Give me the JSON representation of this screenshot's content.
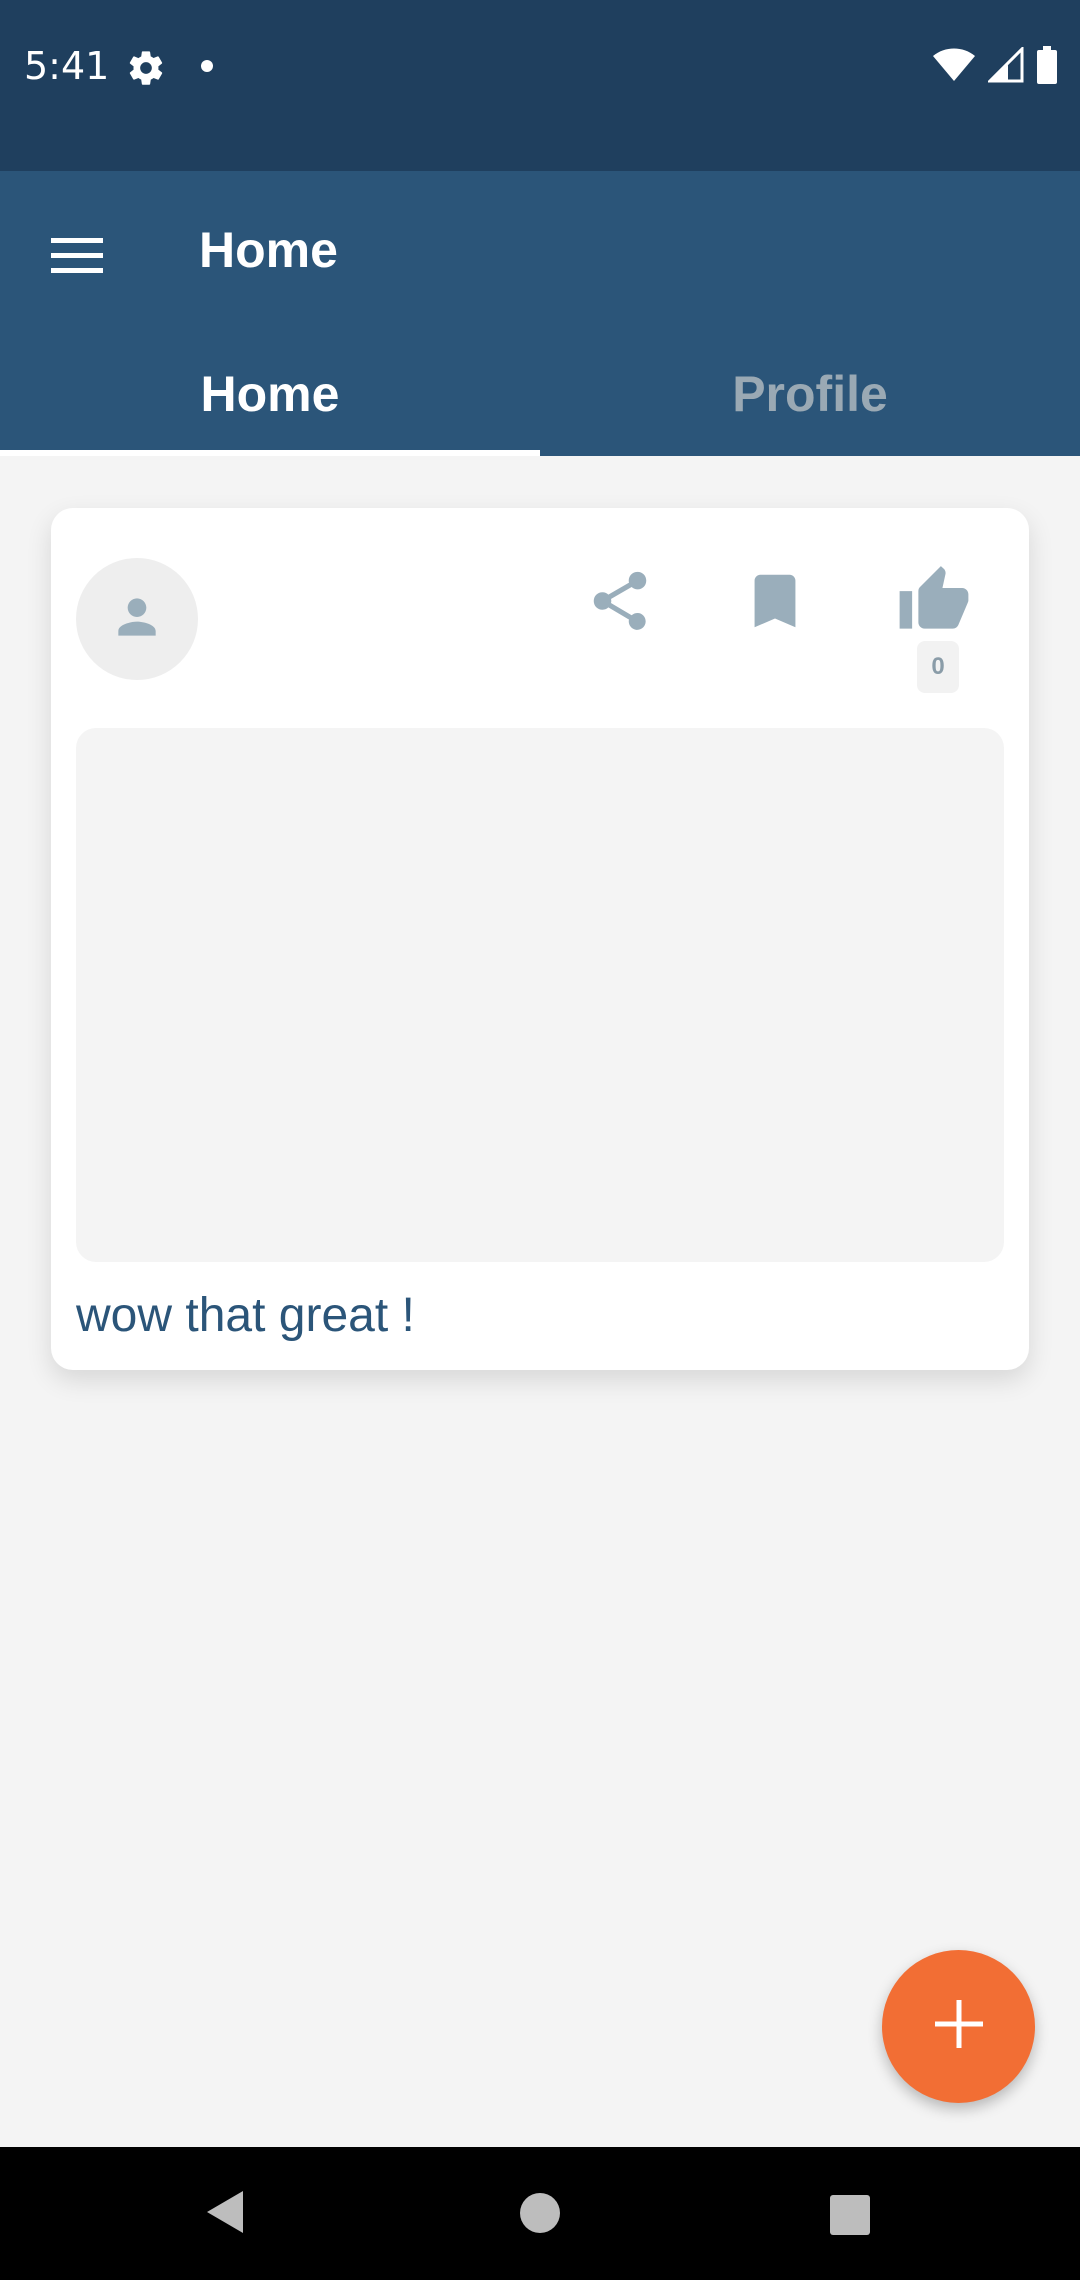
{
  "status_bar": {
    "time": "5:41",
    "icons": [
      "gear-icon",
      "notification-dot-icon",
      "wifi-icon",
      "signal-icon",
      "battery-icon"
    ]
  },
  "app_bar": {
    "title": "Home",
    "menu_icon": "menu-icon"
  },
  "tabs": [
    {
      "label": "Home",
      "selected": true
    },
    {
      "label": "Profile",
      "selected": false
    }
  ],
  "post": {
    "avatar_icon": "person-icon",
    "actions": [
      "share-icon",
      "bookmark-icon",
      "thumbs-up-icon"
    ],
    "like_count": "0",
    "text": "wow that great !"
  },
  "fab": {
    "icon": "plus-icon"
  },
  "nav_bar": {
    "icons": [
      "back-icon",
      "home-icon",
      "recents-icon"
    ]
  },
  "colors": {
    "status_bar": "#1F3F5E",
    "app_bar": "#2B5579",
    "background": "#F4F4F4",
    "accent": "#F26E34",
    "icon_gray": "#9AAEBB"
  }
}
